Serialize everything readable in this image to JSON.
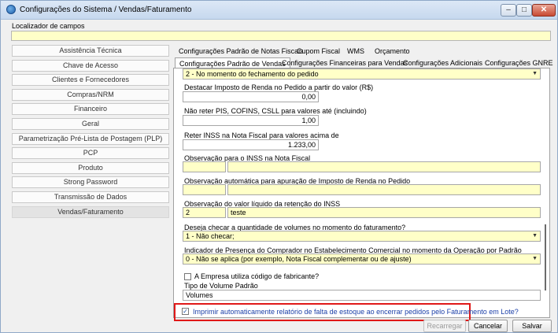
{
  "window": {
    "title": "Configurações do Sistema / Vendas/Faturamento",
    "min_symbol": "–",
    "max_symbol": "□",
    "close_symbol": "✕"
  },
  "locator": {
    "label": "Localizador de campos",
    "value": ""
  },
  "sidebar": {
    "items": [
      {
        "label": "Assistência Técnica"
      },
      {
        "label": "Chave de Acesso"
      },
      {
        "label": "Clientes e Fornecedores"
      },
      {
        "label": "Compras/NRM"
      },
      {
        "label": "Financeiro"
      },
      {
        "label": "Geral"
      },
      {
        "label": "Parametrização Pré-Lista de Postagem (PLP)"
      },
      {
        "label": "PCP"
      },
      {
        "label": "Produto"
      },
      {
        "label": "Strong Password"
      },
      {
        "label": "Transmissão de Dados"
      },
      {
        "label": "Vendas/Faturamento"
      }
    ],
    "active": "Vendas/Faturamento"
  },
  "tabs": {
    "row1": [
      "Configurações Padrão de Notas Fiscais",
      "Cupom Fiscal",
      "WMS",
      "Orçamento"
    ],
    "row2": [
      "Configurações Padrão de Vendas",
      "Configurações Financeiras para Vendas",
      "Configurações Adicionais",
      "Configurações GNRE"
    ],
    "selected": "Configurações Padrão de Vendas"
  },
  "form": {
    "top_dropdown": {
      "value": "2 - No momento do fechamento do pedido"
    },
    "imposto_renda": {
      "label": "Destacar Imposto de Renda no Pedido a partir do valor (R$)",
      "value": "0,00"
    },
    "nao_reter": {
      "label": "Não reter PIS, COFINS, CSLL para valores até (incluindo)",
      "value": "1,00"
    },
    "reter_inss": {
      "label": "Reter INSS na Nota Fiscal para valores acima de",
      "value": "1.233,00"
    },
    "obs_inss": {
      "label": "Observação para o INSS na Nota Fiscal",
      "code": "",
      "text": ""
    },
    "obs_ir": {
      "label": "Observação automática para apuração de Imposto de Renda no Pedido",
      "code": "",
      "text": ""
    },
    "obs_liquido": {
      "label": "Observação do valor líquido da retenção do INSS",
      "code": "2",
      "text": "teste"
    },
    "checar_volumes": {
      "label": "Deseja checar a quantidade de volumes no momento do faturamento?",
      "value": "1 - Não checar;"
    },
    "presenca_comprador": {
      "label": "Indicador de Presença do Comprador no Estabelecimento Comercial no momento da Operação por Padrão",
      "value": "0 - Não se aplica (por exemplo, Nota Fiscal complementar ou de ajuste)"
    },
    "codigo_fabricante": {
      "label": "A Empresa utiliza código de fabricante?",
      "checked": false
    },
    "tipo_volume": {
      "label": "Tipo de Volume Padrão",
      "value": "Volumes"
    },
    "imprimir_relatorio": {
      "label": "Imprimir automaticamente relatório de falta de estoque ao encerrar pedidos pelo Faturamento em Lote?",
      "checked": true
    }
  },
  "buttons": {
    "recarregar": "Recarregar",
    "cancelar": "Cancelar",
    "salvar": "Salvar"
  },
  "colors": {
    "input_yellow": "#ffffc8",
    "highlight_red": "#e01818",
    "checked_label_blue": "#1b3fa8"
  },
  "icons": {
    "dropdown": "▼",
    "check": "✓"
  }
}
